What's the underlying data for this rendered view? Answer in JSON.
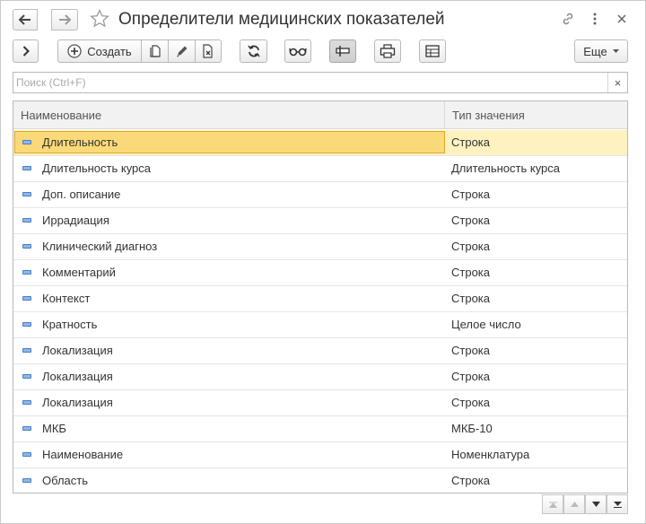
{
  "window": {
    "title": "Определители медицинских показателей"
  },
  "toolbar": {
    "create_label": "Создать",
    "more_label": "Еще"
  },
  "search": {
    "placeholder": "Поиск (Ctrl+F)",
    "value": "",
    "clear_symbol": "×"
  },
  "table": {
    "columns": [
      "Наименование",
      "Тип значения"
    ],
    "rows": [
      {
        "name": "Длительность",
        "type": "Строка",
        "selected": true
      },
      {
        "name": "Длительность курса",
        "type": "Длительность курса"
      },
      {
        "name": "Доп. описание",
        "type": "Строка"
      },
      {
        "name": "Иррадиация",
        "type": "Строка"
      },
      {
        "name": "Клинический диагноз",
        "type": "Строка"
      },
      {
        "name": "Комментарий",
        "type": "Строка"
      },
      {
        "name": "Контекст",
        "type": "Строка"
      },
      {
        "name": "Кратность",
        "type": "Целое число"
      },
      {
        "name": "Локализация",
        "type": "Строка"
      },
      {
        "name": "Локализация",
        "type": "Строка"
      },
      {
        "name": "Локализация",
        "type": "Строка"
      },
      {
        "name": "МКБ",
        "type": "МКБ-10"
      },
      {
        "name": "Наименование",
        "type": "Номенклатура"
      },
      {
        "name": "Область",
        "type": "Строка"
      }
    ]
  },
  "icons": {
    "back": "arrow-left-icon",
    "forward": "arrow-right-icon",
    "favorite": "star-icon",
    "link": "link-icon",
    "menu": "kebab-menu-icon",
    "close": "close-icon",
    "expand": "chevron-right-icon",
    "create": "plus-circle-icon",
    "copy": "copy-icon",
    "edit": "pencil-icon",
    "delete": "mark-delete-icon",
    "refresh": "refresh-icon",
    "view": "glasses-icon",
    "filter": "filter-icon",
    "print": "printer-icon",
    "table": "table-icon",
    "row": "row-marker-icon"
  },
  "colors": {
    "selection_fill": "#fad979",
    "selection_row": "#fdf2c0",
    "row_marker": "#8cb7e8"
  }
}
